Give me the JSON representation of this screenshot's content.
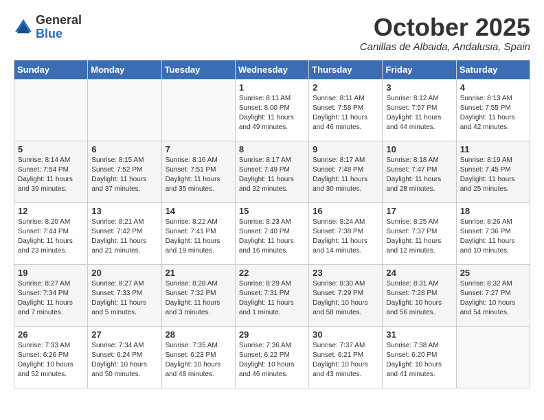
{
  "header": {
    "logo_general": "General",
    "logo_blue": "Blue",
    "month": "October 2025",
    "location": "Canillas de Albaida, Andalusia, Spain"
  },
  "days_of_week": [
    "Sunday",
    "Monday",
    "Tuesday",
    "Wednesday",
    "Thursday",
    "Friday",
    "Saturday"
  ],
  "weeks": [
    [
      {
        "day": "",
        "info": ""
      },
      {
        "day": "",
        "info": ""
      },
      {
        "day": "",
        "info": ""
      },
      {
        "day": "1",
        "info": "Sunrise: 8:11 AM\nSunset: 8:00 PM\nDaylight: 11 hours\nand 49 minutes."
      },
      {
        "day": "2",
        "info": "Sunrise: 8:11 AM\nSunset: 7:58 PM\nDaylight: 11 hours\nand 46 minutes."
      },
      {
        "day": "3",
        "info": "Sunrise: 8:12 AM\nSunset: 7:57 PM\nDaylight: 11 hours\nand 44 minutes."
      },
      {
        "day": "4",
        "info": "Sunrise: 8:13 AM\nSunset: 7:55 PM\nDaylight: 11 hours\nand 42 minutes."
      }
    ],
    [
      {
        "day": "5",
        "info": "Sunrise: 8:14 AM\nSunset: 7:54 PM\nDaylight: 11 hours\nand 39 minutes."
      },
      {
        "day": "6",
        "info": "Sunrise: 8:15 AM\nSunset: 7:52 PM\nDaylight: 11 hours\nand 37 minutes."
      },
      {
        "day": "7",
        "info": "Sunrise: 8:16 AM\nSunset: 7:51 PM\nDaylight: 11 hours\nand 35 minutes."
      },
      {
        "day": "8",
        "info": "Sunrise: 8:17 AM\nSunset: 7:49 PM\nDaylight: 11 hours\nand 32 minutes."
      },
      {
        "day": "9",
        "info": "Sunrise: 8:17 AM\nSunset: 7:48 PM\nDaylight: 11 hours\nand 30 minutes."
      },
      {
        "day": "10",
        "info": "Sunrise: 8:18 AM\nSunset: 7:47 PM\nDaylight: 11 hours\nand 28 minutes."
      },
      {
        "day": "11",
        "info": "Sunrise: 8:19 AM\nSunset: 7:45 PM\nDaylight: 11 hours\nand 25 minutes."
      }
    ],
    [
      {
        "day": "12",
        "info": "Sunrise: 8:20 AM\nSunset: 7:44 PM\nDaylight: 11 hours\nand 23 minutes."
      },
      {
        "day": "13",
        "info": "Sunrise: 8:21 AM\nSunset: 7:42 PM\nDaylight: 11 hours\nand 21 minutes."
      },
      {
        "day": "14",
        "info": "Sunrise: 8:22 AM\nSunset: 7:41 PM\nDaylight: 11 hours\nand 19 minutes."
      },
      {
        "day": "15",
        "info": "Sunrise: 8:23 AM\nSunset: 7:40 PM\nDaylight: 11 hours\nand 16 minutes."
      },
      {
        "day": "16",
        "info": "Sunrise: 8:24 AM\nSunset: 7:38 PM\nDaylight: 11 hours\nand 14 minutes."
      },
      {
        "day": "17",
        "info": "Sunrise: 8:25 AM\nSunset: 7:37 PM\nDaylight: 11 hours\nand 12 minutes."
      },
      {
        "day": "18",
        "info": "Sunrise: 8:26 AM\nSunset: 7:36 PM\nDaylight: 11 hours\nand 10 minutes."
      }
    ],
    [
      {
        "day": "19",
        "info": "Sunrise: 8:27 AM\nSunset: 7:34 PM\nDaylight: 11 hours\nand 7 minutes."
      },
      {
        "day": "20",
        "info": "Sunrise: 8:27 AM\nSunset: 7:33 PM\nDaylight: 11 hours\nand 5 minutes."
      },
      {
        "day": "21",
        "info": "Sunrise: 8:28 AM\nSunset: 7:32 PM\nDaylight: 11 hours\nand 3 minutes."
      },
      {
        "day": "22",
        "info": "Sunrise: 8:29 AM\nSunset: 7:31 PM\nDaylight: 11 hours\nand 1 minute."
      },
      {
        "day": "23",
        "info": "Sunrise: 8:30 AM\nSunset: 7:29 PM\nDaylight: 10 hours\nand 58 minutes."
      },
      {
        "day": "24",
        "info": "Sunrise: 8:31 AM\nSunset: 7:28 PM\nDaylight: 10 hours\nand 56 minutes."
      },
      {
        "day": "25",
        "info": "Sunrise: 8:32 AM\nSunset: 7:27 PM\nDaylight: 10 hours\nand 54 minutes."
      }
    ],
    [
      {
        "day": "26",
        "info": "Sunrise: 7:33 AM\nSunset: 6:26 PM\nDaylight: 10 hours\nand 52 minutes."
      },
      {
        "day": "27",
        "info": "Sunrise: 7:34 AM\nSunset: 6:24 PM\nDaylight: 10 hours\nand 50 minutes."
      },
      {
        "day": "28",
        "info": "Sunrise: 7:35 AM\nSunset: 6:23 PM\nDaylight: 10 hours\nand 48 minutes."
      },
      {
        "day": "29",
        "info": "Sunrise: 7:36 AM\nSunset: 6:22 PM\nDaylight: 10 hours\nand 46 minutes."
      },
      {
        "day": "30",
        "info": "Sunrise: 7:37 AM\nSunset: 6:21 PM\nDaylight: 10 hours\nand 43 minutes."
      },
      {
        "day": "31",
        "info": "Sunrise: 7:38 AM\nSunset: 6:20 PM\nDaylight: 10 hours\nand 41 minutes."
      },
      {
        "day": "",
        "info": ""
      }
    ]
  ]
}
